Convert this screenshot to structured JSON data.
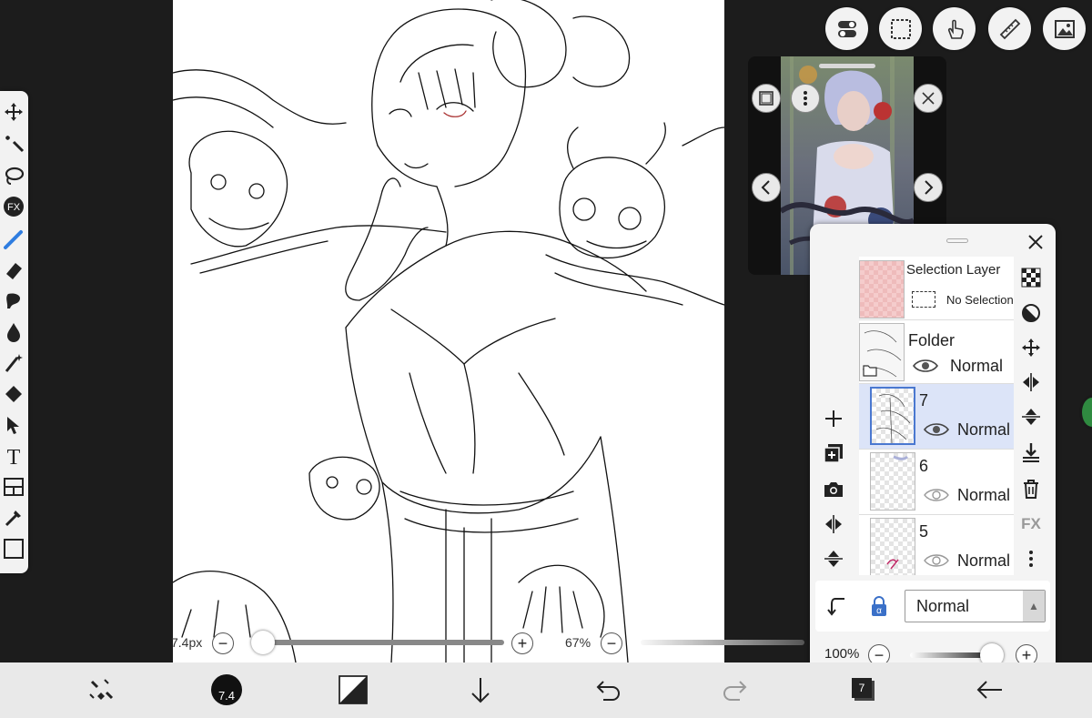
{
  "colors": {
    "canvas_bg": "#ffffff",
    "app_bg": "#1c1c1c",
    "selected_layer": "#dce4f8",
    "accent": "#2f7de0"
  },
  "toolbar": {
    "tools": [
      {
        "name": "move-tool",
        "icon": "move-icon"
      },
      {
        "name": "magic-wand-tool",
        "icon": "magic-wand-icon"
      },
      {
        "name": "lasso-tool",
        "icon": "lasso-icon"
      },
      {
        "name": "fx-tool",
        "icon": "fx-icon",
        "label": "FX"
      },
      {
        "name": "brush-tool",
        "icon": "brush-icon",
        "active": true
      },
      {
        "name": "eraser-tool",
        "icon": "eraser-icon"
      },
      {
        "name": "smudge-tool",
        "icon": "smudge-icon"
      },
      {
        "name": "blur-tool",
        "icon": "drop-icon"
      },
      {
        "name": "special-pen-tool",
        "icon": "sparkle-pen-icon"
      },
      {
        "name": "fill-tool",
        "icon": "bucket-icon"
      },
      {
        "name": "select-tool",
        "icon": "cursor-icon"
      },
      {
        "name": "text-tool",
        "icon": "text-icon",
        "label": "T"
      },
      {
        "name": "frame-divider-tool",
        "icon": "frame-icon"
      },
      {
        "name": "eyedropper-tool",
        "icon": "eyedropper-icon"
      },
      {
        "name": "canvas-tool",
        "icon": "canvas-icon"
      }
    ]
  },
  "top_buttons": [
    "toggle-icon",
    "selection-icon",
    "touch-icon",
    "ruler-icon",
    "material-icon"
  ],
  "layers_panel": {
    "selection_layer": {
      "name": "Selection Layer",
      "status": "No Selection"
    },
    "layers": [
      {
        "name": "Folder",
        "mode": "Normal",
        "selected": false,
        "folder": true
      },
      {
        "name": "7",
        "mode": "Normal",
        "selected": true
      },
      {
        "name": "6",
        "mode": "Normal",
        "selected": false
      },
      {
        "name": "5",
        "mode": "Normal",
        "selected": false
      }
    ],
    "blend_mode": "Normal",
    "opacity_label": "100%",
    "opacity": 1.0,
    "side_right_fx": "FX"
  },
  "brush": {
    "size_label": "7.4px",
    "size_fraction": 0.02,
    "opacity_label": "67%",
    "opacity_fraction": 0.67
  },
  "bottom_bar": {
    "brush_size_badge": "7.4",
    "layer_count_badge": "7"
  }
}
